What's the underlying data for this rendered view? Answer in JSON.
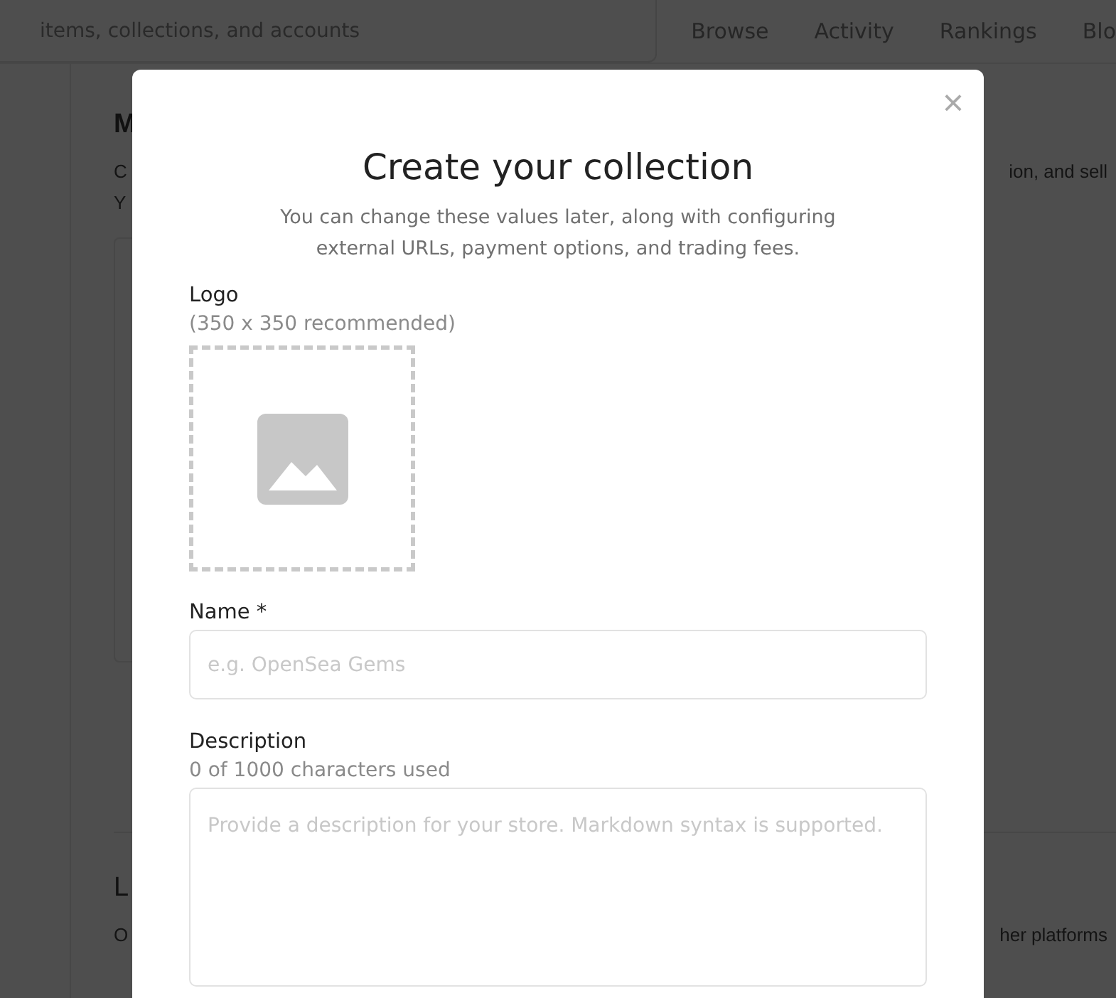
{
  "background": {
    "search_text": "items, collections, and accounts",
    "nav": [
      "Browse",
      "Activity",
      "Rankings",
      "Blo"
    ],
    "fragments_left": [
      "M",
      "C",
      "Y"
    ],
    "fragment_right": "ion, and sell",
    "lower_left": [
      "L",
      "O"
    ],
    "lower_right": "her platforms"
  },
  "modal": {
    "close": "×",
    "title": "Create your collection",
    "subtitle": "You can change these values later, along with configuring external URLs, payment options, and trading fees.",
    "logo": {
      "label": "Logo",
      "hint": "(350 x 350 recommended)"
    },
    "name": {
      "label": "Name *",
      "placeholder": "e.g. OpenSea Gems"
    },
    "description": {
      "label": "Description",
      "hint": "0 of 1000 characters used",
      "placeholder": "Provide a description for your store. Markdown syntax is supported."
    }
  }
}
